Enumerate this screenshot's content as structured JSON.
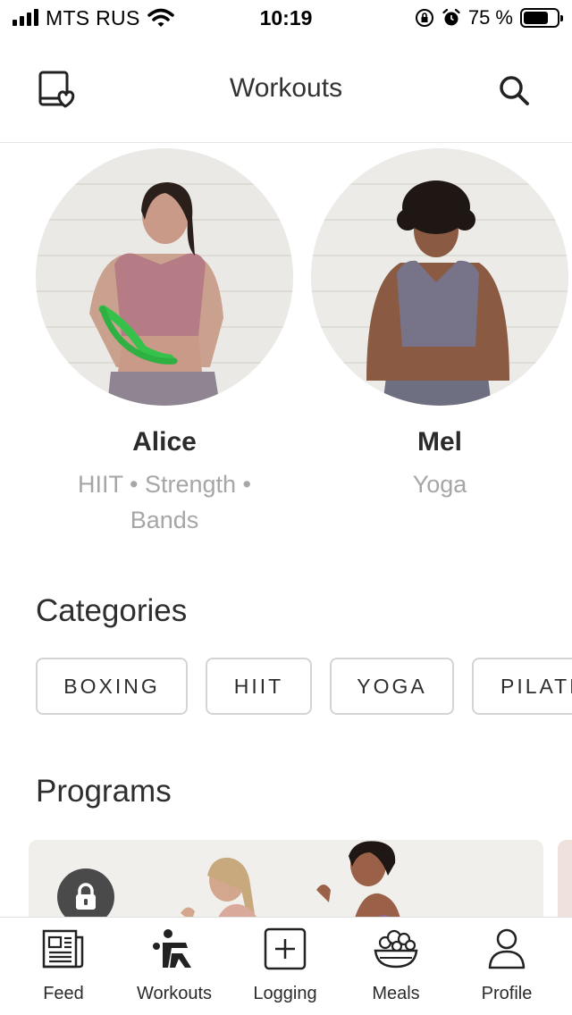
{
  "status_bar": {
    "carrier": "MTS RUS",
    "time": "10:19",
    "battery_percent": "75 %",
    "battery_level": 0.75
  },
  "header": {
    "title": "Workouts",
    "left_icon": "tablet-heart-icon",
    "right_icon": "search-icon"
  },
  "trainers": [
    {
      "name": "Alice",
      "tags": "HIIT • Strength • Bands"
    },
    {
      "name": "Mel",
      "tags": "Yoga"
    }
  ],
  "categories": {
    "title": "Categories",
    "items": [
      "BOXING",
      "HIIT",
      "YOGA",
      "PILATES"
    ]
  },
  "programs": {
    "title": "Programs",
    "card_icon": "lock-icon"
  },
  "tab_bar": {
    "tabs": [
      {
        "label": "Feed",
        "icon": "newspaper-icon"
      },
      {
        "label": "Workouts",
        "icon": "workout-figure-icon"
      },
      {
        "label": "Logging",
        "icon": "plus-square-icon"
      },
      {
        "label": "Meals",
        "icon": "salad-bowl-icon"
      },
      {
        "label": "Profile",
        "icon": "person-icon"
      }
    ]
  }
}
